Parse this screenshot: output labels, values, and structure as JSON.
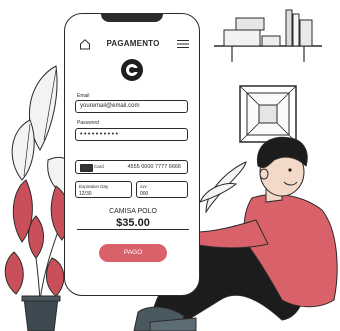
{
  "header": {
    "title": "PAGAMENTO"
  },
  "form": {
    "email_label": "Email",
    "email_value": "youremail@email.com",
    "password_label": "Password",
    "password_value": "••••••••••",
    "card_label": "Card",
    "card_number": "4555 0000 7777 6666",
    "expiration_label": "Expiration Day",
    "expiration_value": "12/30",
    "cvv_label": "cvv",
    "cvv_value": "000"
  },
  "product": {
    "name": "CAMISA POLO",
    "price": "$35.00"
  },
  "pay_button": {
    "label": "PAGO"
  },
  "colors": {
    "accent": "#d9626a",
    "ink": "#2b2b2b",
    "shirt": "#d9626a"
  }
}
